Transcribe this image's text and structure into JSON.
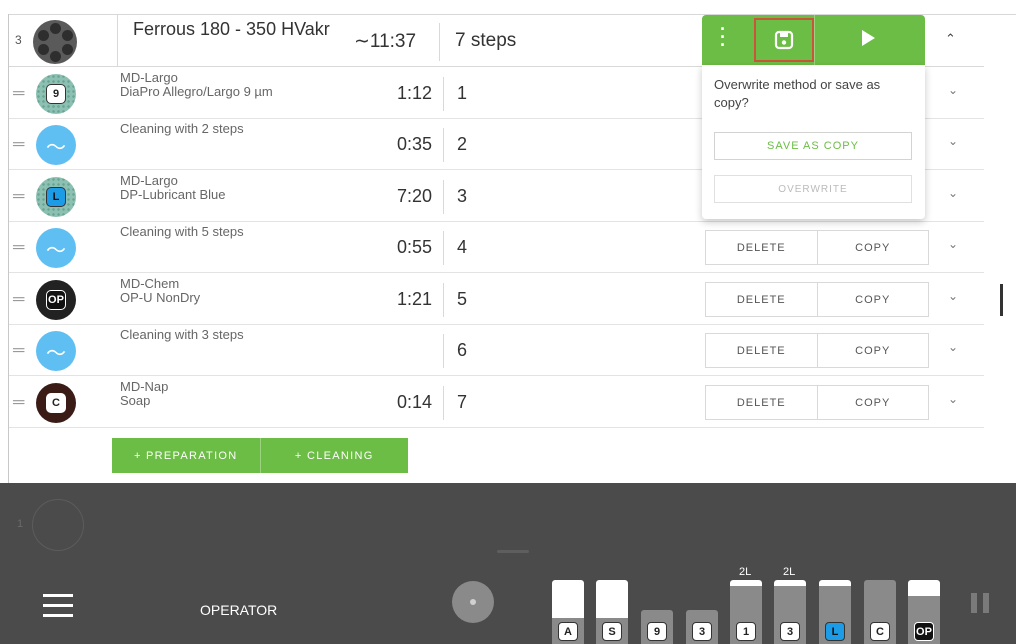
{
  "header": {
    "index": "3",
    "title": "Ferrous 180 - 350 HVakr",
    "time": "∼11:37",
    "steps": "7 steps",
    "chevron": "⌃"
  },
  "steps": [
    {
      "line1": "MD-Largo",
      "line2": "DiaPro Allegro/Largo 9 µm",
      "duration": "1:12",
      "number": "1",
      "icon": "disc-9-icon",
      "badge": "9"
    },
    {
      "line1": "Cleaning with 2 steps",
      "line2": "",
      "duration": "0:35",
      "number": "2",
      "icon": "cleaning-wave-icon",
      "badge": ""
    },
    {
      "line1": "MD-Largo",
      "line2": "DP-Lubricant Blue",
      "duration": "7:20",
      "number": "3",
      "icon": "disc-l-icon",
      "badge": "L"
    },
    {
      "line1": "Cleaning with 5 steps",
      "line2": "",
      "duration": "0:55",
      "number": "4",
      "icon": "cleaning-wave-icon",
      "badge": ""
    },
    {
      "line1": "MD-Chem",
      "line2": "OP-U NonDry",
      "duration": "1:21",
      "number": "5",
      "icon": "disc-op-icon",
      "badge": "OP"
    },
    {
      "line1": "Cleaning with 3 steps",
      "line2": "",
      "duration": "",
      "number": "6",
      "icon": "cleaning-wave-icon",
      "badge": ""
    },
    {
      "line1": "MD-Nap",
      "line2": "Soap",
      "duration": "0:14",
      "number": "7",
      "icon": "disc-c-icon",
      "badge": "C"
    }
  ],
  "row_buttons": {
    "delete": "DELETE",
    "copy": "COPY"
  },
  "add_buttons": {
    "preparation": "+ PREPARATION",
    "cleaning": "+ CLEANING"
  },
  "popup": {
    "message": "Overwrite method or save as copy?",
    "save_as_copy": "SAVE AS COPY",
    "overwrite": "OVERWRITE"
  },
  "bottom": {
    "ghost_index": "1",
    "operator": "OPERATOR",
    "bottles": [
      {
        "label": "A",
        "cap": "",
        "fill": 0.6
      },
      {
        "label": "S",
        "cap": "",
        "fill": 0.6
      },
      {
        "label": "9",
        "cap": "",
        "fill": 0.0
      },
      {
        "label": "3",
        "cap": "",
        "fill": 0.0
      },
      {
        "label": "1",
        "cap": "2L",
        "fill": 0.1
      },
      {
        "label": "3",
        "cap": "2L",
        "fill": 0.1
      },
      {
        "label": "L",
        "cap": "",
        "fill": 0.1
      },
      {
        "label": "C",
        "cap": "",
        "fill": 0.0
      },
      {
        "label": "OP",
        "cap": "",
        "fill": 0.25
      }
    ]
  },
  "colors": {
    "accent_green": "#6cbd45",
    "highlight": "#c9553b",
    "dark_panel": "#4b4b4b",
    "cleaning_blue": "#5fbff3"
  }
}
